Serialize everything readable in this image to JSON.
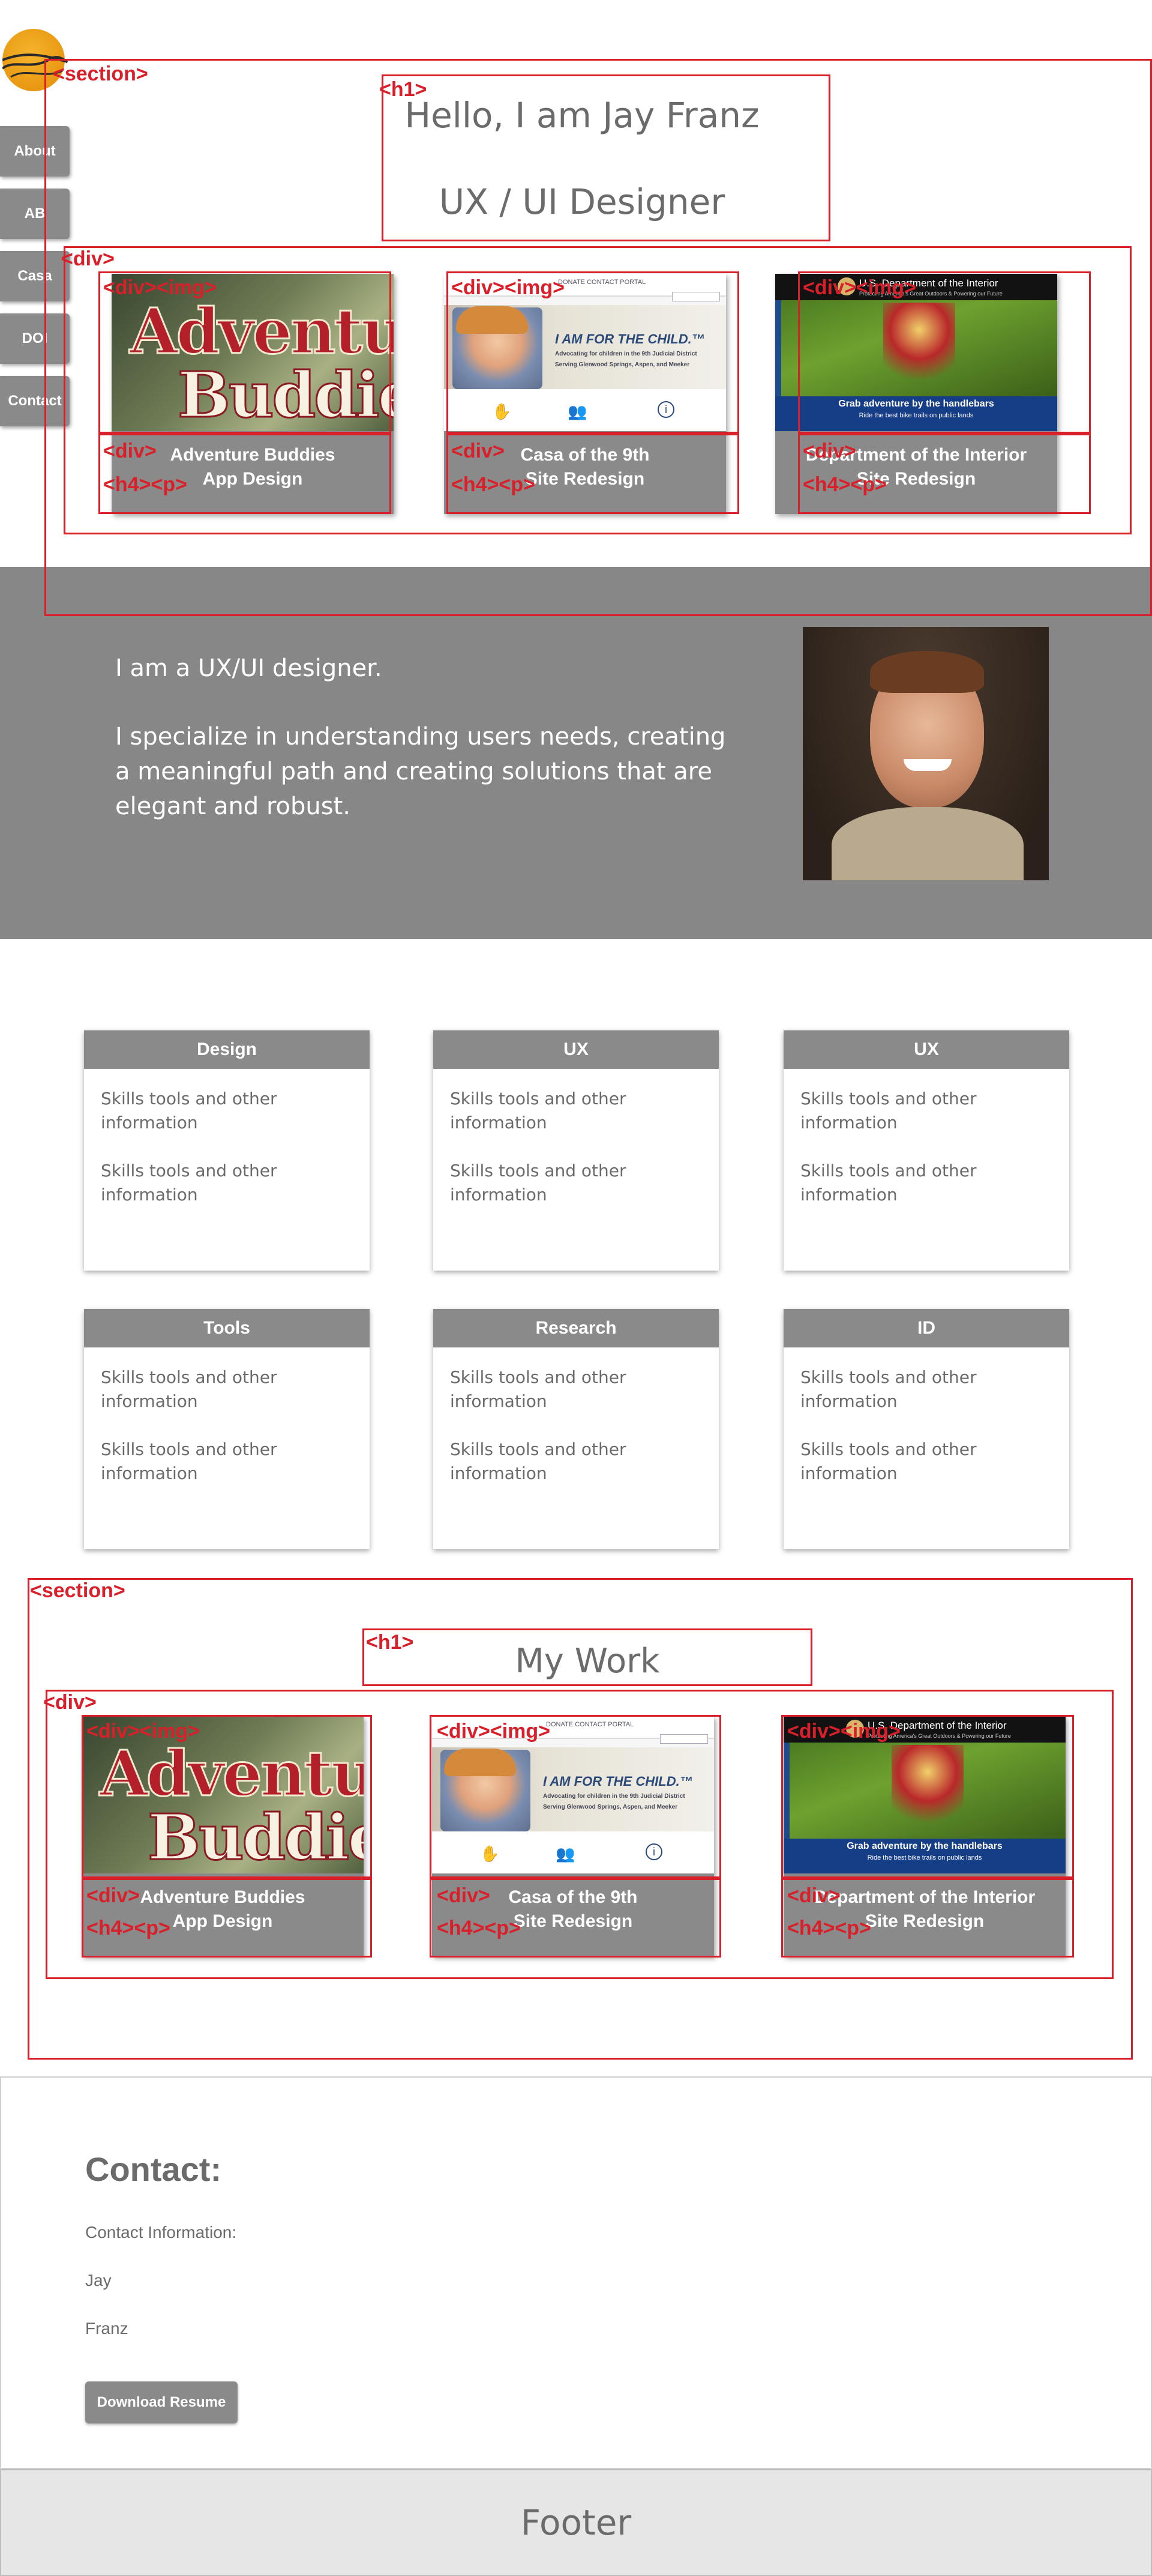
{
  "nav": {
    "items": [
      "About",
      "AB",
      "Casa",
      "DOI",
      "Contact"
    ]
  },
  "hero": {
    "title_line1": "Hello, I am Jay Franz",
    "title_line2": "UX / UI Designer"
  },
  "projects": [
    {
      "heading": "Adventure Buddies",
      "subtitle": "App Design",
      "image_text_1": "Adventure",
      "image_text_2": "Buddies"
    },
    {
      "heading": "Casa of the 9th",
      "subtitle": "Site Redesign",
      "image_headline": "I AM FOR THE CHILD.™",
      "image_sub1": "Advocating for children in the 9th Judicial District",
      "image_sub2": "Serving Glenwood Springs, Aspen, and Meeker",
      "image_nav": "DONATE   CONTACT   PORTAL"
    },
    {
      "heading": "Department of the Interior",
      "subtitle": "Site Redesign",
      "image_header": "U.S. Department of the Interior",
      "image_tagline": "Protecting America's Great Outdoors & Powering our Future",
      "image_caption": "Grab adventure by the handlebars",
      "image_caption_sub": "Ride the best bike trails on public lands"
    }
  ],
  "about": {
    "line1": "I am a UX/UI designer.",
    "line2": "I specialize in understanding users needs, creating a meaningful path and creating solutions that are elegant and robust."
  },
  "skills": [
    {
      "title": "Design",
      "body1": "Skills tools and other information",
      "body2": "Skills tools and other information"
    },
    {
      "title": "UX",
      "body1": "Skills tools and other information",
      "body2": "Skills tools and other information"
    },
    {
      "title": "UX",
      "body1": "Skills tools and other information",
      "body2": "Skills tools and other information"
    },
    {
      "title": "Tools",
      "body1": "Skills tools and other information",
      "body2": "Skills tools and other information"
    },
    {
      "title": "Research",
      "body1": "Skills tools and other information",
      "body2": "Skills tools and other information"
    },
    {
      "title": "ID",
      "body1": "Skills tools and other information",
      "body2": "Skills tools and other information"
    }
  ],
  "work": {
    "title": "My Work"
  },
  "contact": {
    "title": "Contact:",
    "info_label": "Contact Information:",
    "first_name": "Jay",
    "last_name": "Franz",
    "download_label": "Download Resume"
  },
  "footer": {
    "text": "Footer"
  },
  "annotations": {
    "section": "<section>",
    "h1": "<h1>",
    "div": "<div>",
    "div_img": "<div><img>",
    "h4_p": "<h4><p>"
  },
  "colors": {
    "annotation": "#d9202a",
    "panel_gray": "#8a8a8a",
    "about_bg": "#878787",
    "logo_orange": "#f0a11a",
    "text_gray": "#6b6b6b"
  }
}
